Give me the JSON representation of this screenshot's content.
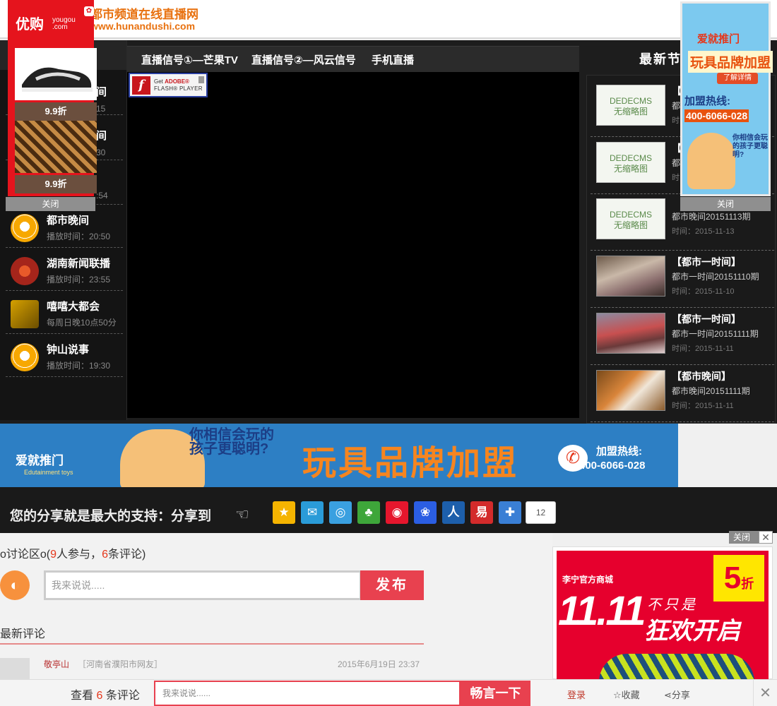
{
  "header": {
    "site_name": "都市频道在线直播网",
    "site_url": "www.hunandushi.com"
  },
  "player": {
    "tabs": [
      "直播信号①—芒果TV",
      "直播信号②—风云信号",
      "手机直播"
    ],
    "flash_get": "Get",
    "flash_adobe": "ADOBE®",
    "flash_player": "FLASH® PLAYER"
  },
  "programs": [
    {
      "name": "都市晚间",
      "time": "播放时间：20:50",
      "icon": "mango-logo-icon"
    },
    {
      "name": "湖南新闻联播",
      "time": "播放时间：23:55",
      "icon": "channel-logo-icon"
    },
    {
      "name": "嘻嘻大都会",
      "time": "每周日晚10点50分",
      "icon": "show-logo-icon"
    },
    {
      "name": "钟山说事",
      "time": "播放时间：19:30",
      "icon": "mango-logo-icon"
    }
  ],
  "program_fragments": {
    "t1": "7:15",
    "t2": "8:30",
    "t3": ":54",
    "n1": "间",
    "n2": "间"
  },
  "latest": {
    "title": "最新节",
    "items": [
      {
        "thumb": "DEDECMS\n无缩略图",
        "title": "【",
        "sub": "都",
        "date": "时"
      },
      {
        "thumb": "DEDECMS\n无缩略图",
        "title": "【",
        "sub": "都",
        "date": "时"
      },
      {
        "thumb": "DEDECMS\n无缩略图",
        "title": "",
        "sub": "都市晚间20151113期",
        "date": "时间：2015-11-13"
      },
      {
        "thumb": "",
        "title": "【都市一时间】",
        "sub": "都市一时间20151110期",
        "date": "时间：2015-11-10"
      },
      {
        "thumb": "",
        "title": "【都市一时间】",
        "sub": "都市一时间20151111期",
        "date": "时间：2015-11-11"
      },
      {
        "thumb": "",
        "title": "【都市晚间】",
        "sub": "都市晚间20151111期",
        "date": "时间：2015-11-11"
      }
    ]
  },
  "shop_ad": {
    "brand": "优购",
    "brand_sub": "yougou\n.com",
    "price1": "9.9折",
    "price2": "9.9折",
    "close": "关闭"
  },
  "toy_ad": {
    "logo": "爱就推门",
    "main": "玩具品牌加盟",
    "more": "了解详情",
    "hotline_label": "加盟热线:",
    "hotline": "400-6066-028",
    "slogan": "你相信会玩的孩子更聪明?",
    "close": "关闭"
  },
  "banner": {
    "logo": "爱就推门",
    "logo_sub": "Edutainment toys",
    "slogan": "你相信会玩的孩子更聪明?",
    "main": "玩具品牌加盟",
    "hotline_label": "加盟热线:",
    "hotline": "400-6066-028"
  },
  "share": {
    "label": "您的分享就是最大的支持：分享到",
    "count": "12",
    "icons": [
      {
        "name": "qzone-icon",
        "glyph": "★",
        "color": "#f5b400"
      },
      {
        "name": "tencent-weibo-icon",
        "glyph": "✉",
        "color": "#2a9bd8"
      },
      {
        "name": "qq-space-icon",
        "glyph": "◎",
        "color": "#3aa0e0"
      },
      {
        "name": "clover-icon",
        "glyph": "♣",
        "color": "#3ea63a"
      },
      {
        "name": "sina-weibo-icon",
        "glyph": "◉",
        "color": "#e6162d"
      },
      {
        "name": "baidu-icon",
        "glyph": "❀",
        "color": "#2b5ee3"
      },
      {
        "name": "renren-icon",
        "glyph": "人",
        "color": "#1d5fab"
      },
      {
        "name": "netease-icon",
        "glyph": "易",
        "color": "#d32b2b"
      },
      {
        "name": "more-share-icon",
        "glyph": "✚",
        "color": "#3a7fd5"
      }
    ]
  },
  "discussion": {
    "title_pre": "o讨论区o(",
    "participants": "9",
    "title_mid": "人参与，",
    "comments": "6",
    "title_post": "条评论)",
    "placeholder": "我来说说.....",
    "post": "发布",
    "latest_label": "最新评论",
    "comment_user": "敬亭山",
    "comment_loc": "［河南省濮阳市网友］",
    "comment_date": "2015年6月19日 23:37"
  },
  "lining_ad": {
    "close": "关闭",
    "brand": "李宁官方商城",
    "discount": "5",
    "discount_unit": "折",
    "title": "11.11",
    "not_only": "不只是",
    "party": "狂欢开启"
  },
  "bottom_bar": {
    "view_pre": "查看",
    "count": "6",
    "view_post": "条评论",
    "placeholder": "我来说说......",
    "post": "畅言一下",
    "login": "登录",
    "fav": "☆收藏",
    "share": "分享"
  }
}
